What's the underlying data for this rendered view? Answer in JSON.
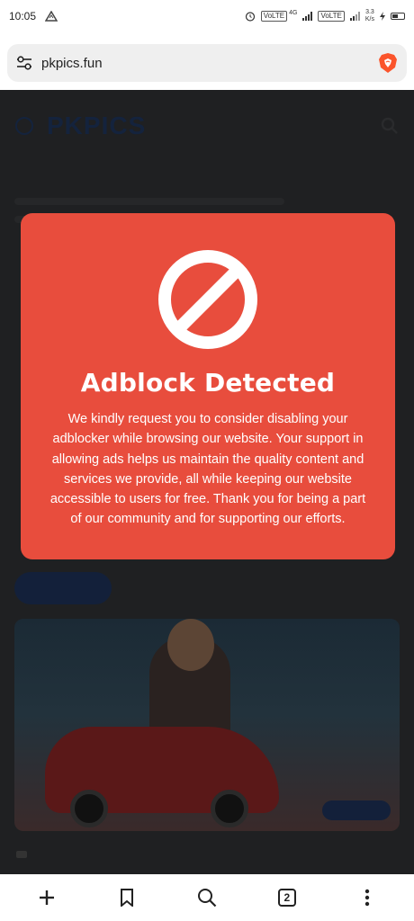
{
  "status_bar": {
    "time": "10:05",
    "network_1": "VoLTE",
    "network_2": "VoLTE",
    "speed": "3.3",
    "speed_unit": "K/s",
    "tech": "4G"
  },
  "browser": {
    "url": "pkpics.fun",
    "tab_count": "2"
  },
  "site": {
    "logo_text": "PKPICS"
  },
  "modal": {
    "title": "Adblock Detected",
    "message": "We kindly request you to consider disabling your adblocker while browsing our website. Your support in allowing ads helps us maintain the quality content and services we provide, all while keeping our website accessible to users for free. Thank you for being a part of our community and for supporting our efforts.",
    "background_color": "#e84d3d"
  },
  "icons": {
    "address_left": "site-settings-icon",
    "address_right": "brave-shield-icon",
    "modal": "no-entry-icon",
    "toolbar": [
      "add-icon",
      "bookmark-icon",
      "search-icon",
      "tabs-icon",
      "more-icon"
    ]
  }
}
